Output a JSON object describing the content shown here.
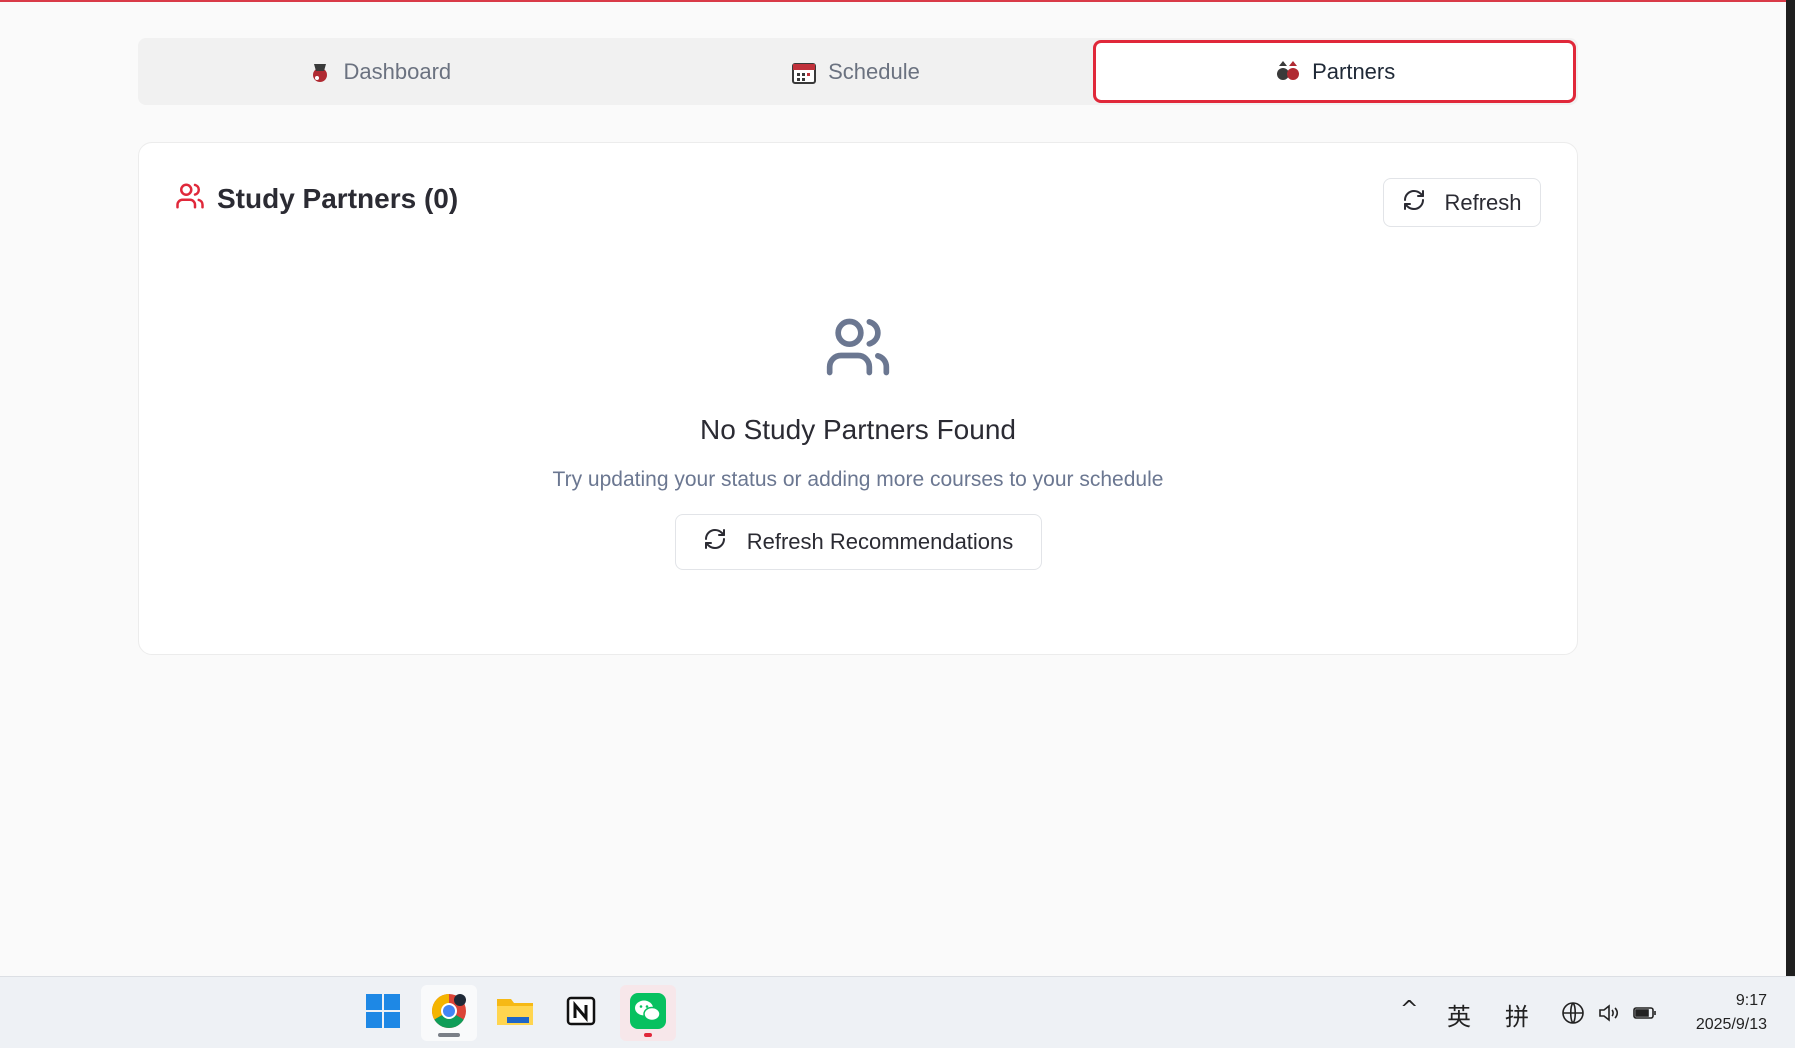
{
  "tabs": [
    {
      "label": "Dashboard",
      "icon": "dashboard-icon",
      "active": false
    },
    {
      "label": "Schedule",
      "icon": "calendar-icon",
      "active": false
    },
    {
      "label": "Partners",
      "icon": "partners-icon",
      "active": true
    }
  ],
  "card": {
    "title": "Study Partners (0)",
    "refresh_label": "Refresh",
    "empty_title": "No Study Partners Found",
    "empty_description": "Try updating your status or adding more courses to your schedule",
    "recommendations_label": "Refresh Recommendations"
  },
  "colors": {
    "accent": "#e0283a",
    "muted_text": "#6b7791",
    "empty_icon": "#6b7791"
  },
  "taskbar": {
    "apps": [
      "windows-start-icon",
      "chrome-icon",
      "file-explorer-icon",
      "notion-icon",
      "wechat-icon"
    ],
    "tray": {
      "chevron": "^",
      "ime_lang": "英",
      "ime_mode": "拼"
    },
    "clock": {
      "time": "9:17",
      "date": "2025/9/13"
    }
  }
}
